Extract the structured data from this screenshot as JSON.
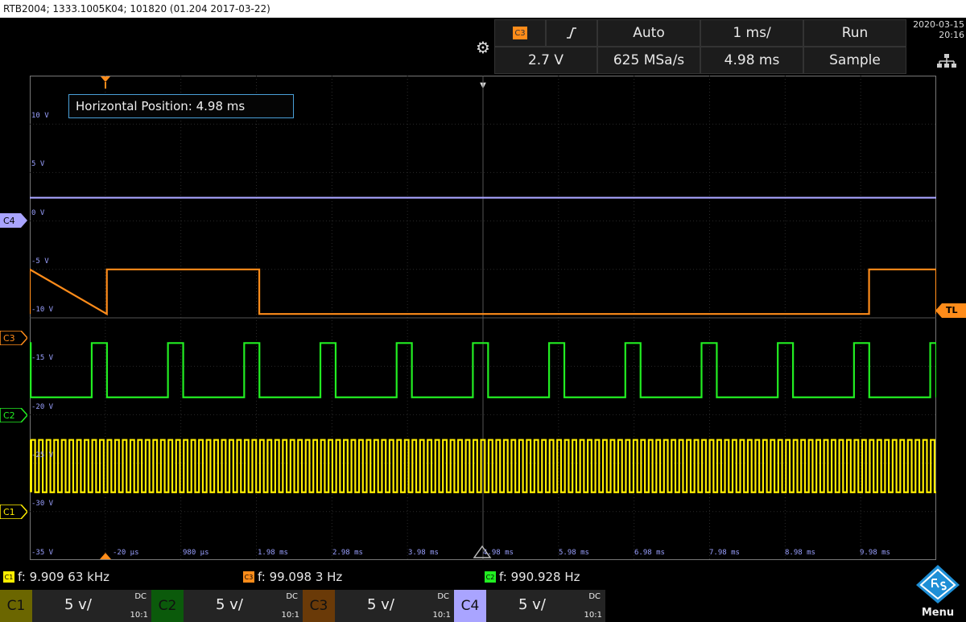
{
  "title_bar": "RTB2004; 1333.1005K04; 101820 (01.204 2017-03-22)",
  "top": {
    "trigger_source": "C3",
    "trigger_slope_icon": "rising-edge-icon",
    "trigger_mode": "Auto",
    "timebase": "1 ms/",
    "run_state": "Run",
    "trigger_level": "2.7 V",
    "sample_rate": "625 MSa/s",
    "horizontal_position": "4.98 ms",
    "acquisition_mode": "Sample",
    "date": "2020-03-15",
    "time": "20:16"
  },
  "overlay": {
    "hpos_label": "Horizontal Position: 4.98 ms"
  },
  "y_labels": [
    "10 V",
    "5 V",
    "0 V",
    "-5 V",
    "-10 V",
    "-15 V",
    "-20 V",
    "-25 V",
    "-30 V",
    "-35 V"
  ],
  "x_labels": [
    "-20 µs",
    "980 µs",
    "1.98 ms",
    "2.98 ms",
    "3.98 ms",
    "4.98 ms",
    "5.98 ms",
    "6.98 ms",
    "7.98 ms",
    "8.98 ms",
    "9.98 ms"
  ],
  "channel_markers": {
    "c4": "C4",
    "c3": "C3",
    "c2": "C2",
    "c1": "C1",
    "trigger_level": "TL"
  },
  "measurements": [
    {
      "ch": "C1",
      "text": "f: 9.909 63 kHz",
      "color": "#ffee00"
    },
    {
      "ch": "C3",
      "text": "f: 99.098 3 Hz",
      "color": "#ff8c1a"
    },
    {
      "ch": "C2",
      "text": "f: 990.928 Hz",
      "color": "#22ee22"
    }
  ],
  "channels": [
    {
      "name": "C1",
      "scale": "5 v/",
      "coupling": "DC",
      "probe": "10:1",
      "color": "#ffee00",
      "dark": "#6b6600"
    },
    {
      "name": "C2",
      "scale": "5 v/",
      "coupling": "DC",
      "probe": "10:1",
      "color": "#22ee22",
      "dark": "#0b5a0b"
    },
    {
      "name": "C3",
      "scale": "5 v/",
      "coupling": "DC",
      "probe": "10:1",
      "color": "#ff8c1a",
      "dark": "#6a3a08"
    },
    {
      "name": "C4",
      "scale": "5 v/",
      "coupling": "DC",
      "probe": "10:1",
      "color": "#a9a4ff",
      "dark": "#3c3a70"
    }
  ],
  "menu_label": "Menu",
  "chart_data": {
    "type": "line",
    "xlabel": "",
    "ylabel": "",
    "xlim_ms": [
      -1.02,
      10.98
    ],
    "ylim_V": [
      -38,
      12
    ],
    "grid": true,
    "series": [
      {
        "name": "C4",
        "kind": "flat",
        "level_V": -0.6,
        "color": "#a9a4ff"
      },
      {
        "name": "C3",
        "kind": "square",
        "freq_hz": 99.098,
        "high_V": -8.0,
        "low_V": -12.6,
        "first_rise_ms": 0.0,
        "duty": 0.2,
        "color": "#ff8c1a"
      },
      {
        "name": "C2",
        "kind": "square",
        "freq_hz": 990.928,
        "high_V": -15.6,
        "low_V": -21.2,
        "first_rise_ms": -0.2,
        "duty": 0.2,
        "color": "#22ee22"
      },
      {
        "name": "C1",
        "kind": "square",
        "freq_hz": 9909.63,
        "high_V": -25.6,
        "low_V": -31.0,
        "first_rise_ms": -1.0,
        "duty": 0.5,
        "color": "#ffee00"
      }
    ]
  }
}
